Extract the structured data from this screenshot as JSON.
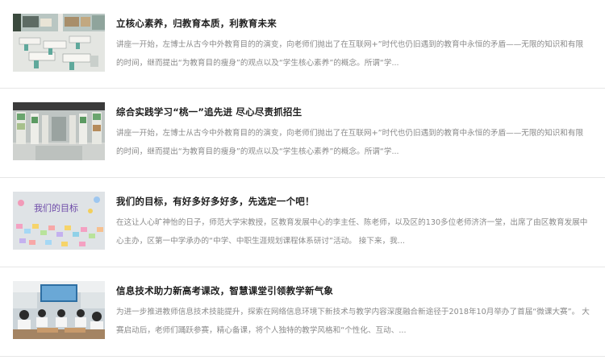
{
  "articles": [
    {
      "title": "立核心素养，归教育本质，利教育未来",
      "summary": "讲座一开始，左博士从古今中外教育目的的演变，向老师们抛出了在互联网+”时代也仍旧遇到的教育中永恒的矛盾——无限的知识和有限的时间，继而提出“为教育目的瘦身”的观点以及“学生核心素养”的概念。所谓“学...",
      "image": "classroom-tables-photo"
    },
    {
      "title": "综合实践学习“桃一”追先进 尽心尽责抓招生",
      "summary": "讲座一开始，左博士从古今中外教育目的的演变，向老师们抛出了在互联网+”时代也仍旧遇到的教育中永恒的矛盾——无限的知识和有限的时间，继而提出“为教育目的瘦身”的观点以及“学生核心素养”的概念。所谓“学...",
      "image": "exhibition-hall-photo"
    },
    {
      "title": "我们的目标，有好多好多好多，先选定一个吧！",
      "summary": "在这让人心旷神怡的日子，师范大学宋教授，区教育发展中心的李主任、陈老师，以及区的130多位老师济济一堂，出席了由区教育发展中心主办，区第一中学承办的“中学、中职生涯规划课程体系研讨”活动。 接下来，我...",
      "image": "goals-wall-photo",
      "image_text": "我们的目标"
    },
    {
      "title": "信息技术助力新高考课改，智慧课堂引领教学新气象",
      "summary": "为进一步推进教师信息技术技能提升，探索在网络信息环境下新技术与教学内容深度融合新途径于2018年10月举办了首届“微课大赛”。 大赛启动后，老师们踊跃参赛，精心备课，将个人独特的教学风格和“个性化、互动、...",
      "image": "students-classroom-photo"
    }
  ]
}
